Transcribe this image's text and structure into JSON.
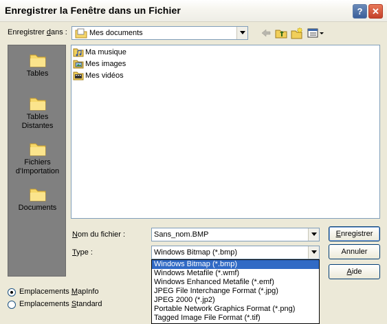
{
  "window": {
    "title": "Enregistrer la Fenêtre dans un Fichier",
    "help_label": "?",
    "close_label": "✕"
  },
  "savein": {
    "label_pre": "Enregistrer ",
    "label_u": "d",
    "label_post": "ans :",
    "value": "Mes documents"
  },
  "toolbar": {
    "icons": [
      "back-arrow-icon",
      "up-folder-icon",
      "new-folder-icon",
      "view-menu-icon"
    ]
  },
  "places": [
    {
      "label": "Tables",
      "icon": "folder-icon"
    },
    {
      "label": "Tables Distantes",
      "icon": "folder-icon"
    },
    {
      "label": "Fichiers d'Importation",
      "icon": "folder-icon"
    },
    {
      "label": "Documents",
      "icon": "folder-icon"
    }
  ],
  "files": [
    {
      "name": "Ma musique",
      "icon": "music-folder-icon"
    },
    {
      "name": "Mes images",
      "icon": "pictures-folder-icon"
    },
    {
      "name": "Mes vidéos",
      "icon": "video-folder-icon"
    }
  ],
  "filename": {
    "label_u": "N",
    "label_post": "om du fichier :",
    "value": "Sans_nom.BMP"
  },
  "filetype": {
    "label_u": "T",
    "label_post": "ype :",
    "value": "Windows Bitmap (*.bmp)",
    "options": [
      "Windows Bitmap (*.bmp)",
      "Windows Metafile (*.wmf)",
      "Windows Enhanced Metafile (*.emf)",
      "JPEG File Interchange Format (*.jpg)",
      "JPEG 2000 (*.jp2)",
      "Portable Network Graphics Format (*.png)",
      "Tagged Image File Format (*.tif)"
    ],
    "selected_index": 0
  },
  "buttons": {
    "save_u": "E",
    "save_post": "nregistrer",
    "cancel": "Annuler",
    "help_u": "A",
    "help_post": "ide"
  },
  "locations": {
    "mapinfo_pre": "Emplacements ",
    "mapinfo_u": "M",
    "mapinfo_post": "apInfo",
    "standard_pre": "Emplacements ",
    "standard_u": "S",
    "standard_post": "tandard",
    "selected": "mapinfo"
  },
  "colors": {
    "selection": "#316ac5",
    "dialog_bg": "#ece9d8",
    "places_bg": "#808080"
  }
}
